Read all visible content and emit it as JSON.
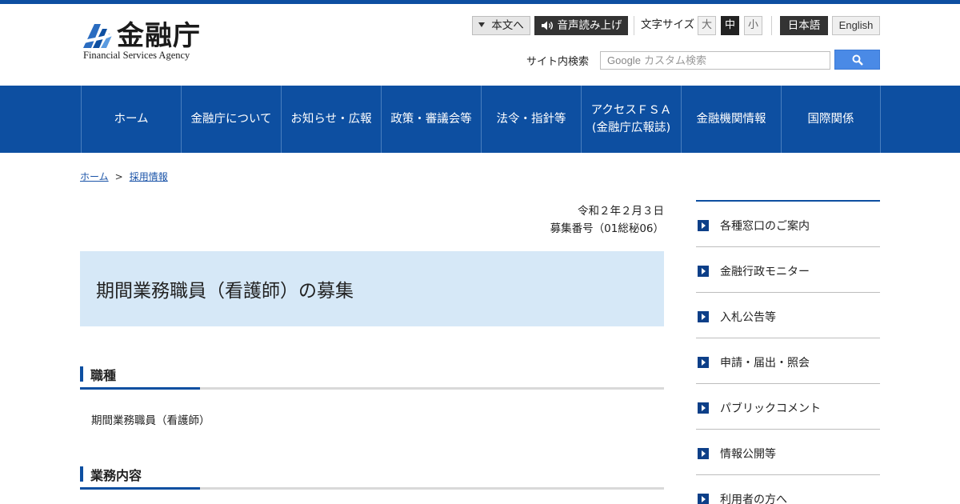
{
  "header": {
    "logo_name": "金融庁",
    "logo_en": "Financial Services Agency",
    "skip_label": "本文へ",
    "read_aloud_label": "音声読み上げ",
    "font_size_label": "文字サイズ",
    "font_sizes": [
      "大",
      "中",
      "小"
    ],
    "font_size_selected": "中",
    "lang_ja": "日本語",
    "lang_en": "English",
    "search_label": "サイト内検索",
    "search_placeholder_brand": "Google",
    "search_placeholder_text": " カスタム検索"
  },
  "nav": {
    "items": [
      {
        "label": "ホーム"
      },
      {
        "label": "金融庁について"
      },
      {
        "label": "お知らせ・広報"
      },
      {
        "label": "政策・審議会等"
      },
      {
        "label": "法令・指針等"
      },
      {
        "label": "アクセスＦＳＡ",
        "label2": "(金融庁広報誌)"
      },
      {
        "label": "金融機関情報"
      },
      {
        "label": "国際関係"
      }
    ]
  },
  "breadcrumb": {
    "home": "ホーム",
    "separator": ">",
    "current": "採用情報"
  },
  "main": {
    "date": "令和２年２月３日",
    "recruit_no": "募集番号（01総秘06）",
    "title": "期間業務職員（看護師）の募集",
    "sections": [
      {
        "heading": "職種",
        "body": "期間業務職員（看護師）"
      },
      {
        "heading": "業務内容"
      }
    ]
  },
  "sidebar": {
    "items": [
      {
        "label": "各種窓口のご案内"
      },
      {
        "label": "金融行政モニター"
      },
      {
        "label": "入札公告等"
      },
      {
        "label": "申請・届出・照会"
      },
      {
        "label": "パブリックコメント"
      },
      {
        "label": "情報公開等"
      },
      {
        "label": "利用者の方へ"
      }
    ]
  },
  "colors": {
    "brand_blue": "#0d4fa1",
    "title_bg": "#d6e8f7",
    "search_button": "#4a8ae6"
  },
  "icons": {
    "skip": "triangle-down-icon",
    "read_aloud": "speaker-icon",
    "search": "magnifier-icon",
    "side_bullet": "square-arrow-right-icon"
  }
}
